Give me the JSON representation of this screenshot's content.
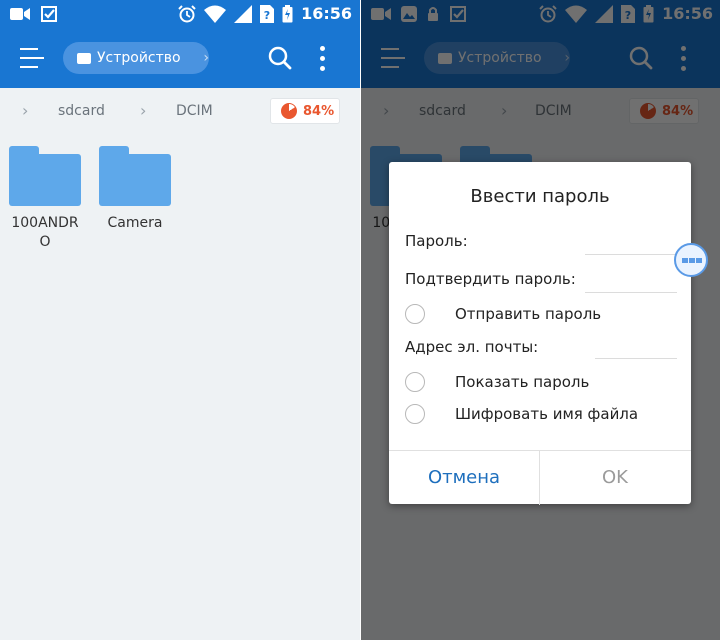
{
  "status_bar": {
    "time": "16:56"
  },
  "app_bar": {
    "location": "Устройство"
  },
  "breadcrumb": {
    "items": [
      "sdcard",
      "DCIM"
    ],
    "storage_used": "84%"
  },
  "files": [
    {
      "name": "100ANDRO"
    },
    {
      "name": "Camera"
    }
  ],
  "dialog": {
    "title": "Ввести пароль",
    "password_label": "Пароль:",
    "confirm_label": "Подтвердить пароль:",
    "send_password": "Отправить пароль",
    "email_label": "Адрес эл. почты:",
    "show_password": "Показать пароль",
    "encrypt_filename": "Шифровать имя файла",
    "cancel": "Отмена",
    "ok": "OK"
  },
  "colors": {
    "app_bar": "#1976d2",
    "storage_accent": "#e9572f",
    "folder": "#5ea8ea",
    "cancel_text": "#1e6fbd"
  },
  "icons": [
    "video-icon",
    "download-check-icon",
    "gallery-icon",
    "lock-icon",
    "alarm-icon",
    "wifi-icon",
    "signal-icon",
    "sim-icon",
    "battery-icon",
    "hamburger-icon",
    "device-icon",
    "search-icon",
    "overflow-menu-icon",
    "chevron-right-icon",
    "storage-pie-icon",
    "folder-icon"
  ]
}
